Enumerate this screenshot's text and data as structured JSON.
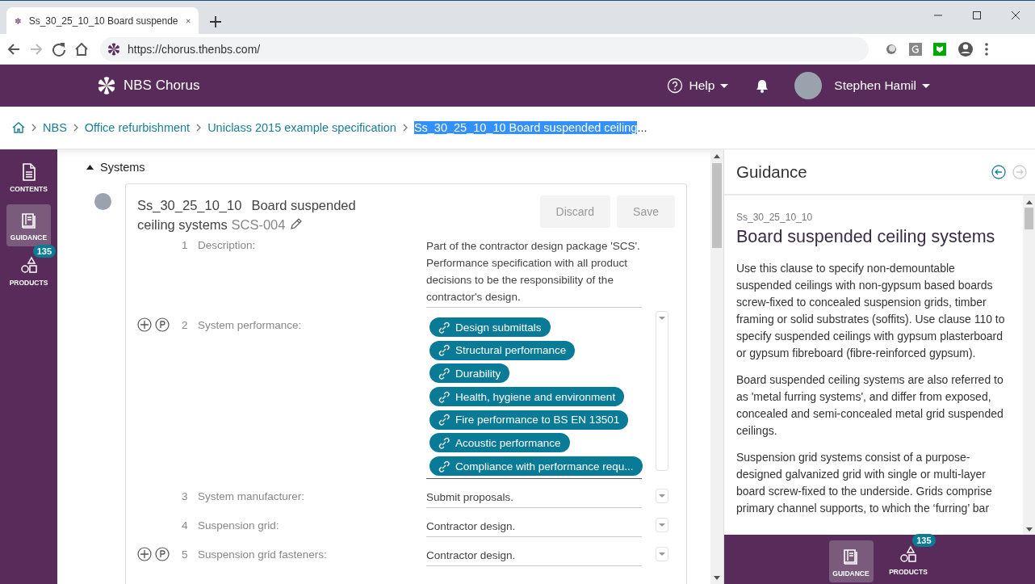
{
  "browser": {
    "tab_title": "Ss_30_25_10_10 Board suspende",
    "url": "https://chorus.thenbs.com/",
    "forward_disabled": true
  },
  "header": {
    "app_name": "NBS Chorus",
    "help": "Help",
    "user": "Stephen Hamil"
  },
  "breadcrumb": {
    "items": [
      "NBS",
      "Office refurbishment",
      "Uniclass 2015 example specification"
    ],
    "current": {
      "text": "Ss_30_25_10_10 Board suspended ceiling",
      "suffix": "...",
      "highlighted": true
    }
  },
  "rail": {
    "items": [
      {
        "kind": "contents",
        "label": "CONTENTS",
        "selected": false
      },
      {
        "kind": "guidance",
        "label": "GUIDANCE",
        "selected": true
      },
      {
        "kind": "products",
        "label": "PRODUCTS",
        "selected": false,
        "badge": "135"
      }
    ]
  },
  "section": {
    "title": "Systems",
    "expanded": true
  },
  "clause": {
    "code": "Ss_30_25_10_10",
    "title": "Board suspended ceiling systems",
    "reference": "SCS-004",
    "buttons": [
      {
        "label": "Discard",
        "disabled": true
      },
      {
        "label": "Save",
        "disabled": true
      }
    ],
    "properties": [
      {
        "kind": "text",
        "number": "1",
        "label": "Description:",
        "actions": false,
        "dropdown": false,
        "value": "Part of the contractor design package 'SCS'. Performance specification with all product decisions to be the responsibility of the contractor's design."
      },
      {
        "kind": "links",
        "number": "2",
        "label": "System performance:",
        "actions": true,
        "dropdown": true,
        "links": [
          "Design submittals",
          "Structural performance",
          "Durability",
          "Health, hygiene and environment",
          "Fire performance to BS EN 13501",
          "Acoustic performance",
          "Compliance with performance requ..."
        ]
      },
      {
        "kind": "text",
        "number": "3",
        "label": "System manufacturer:",
        "actions": false,
        "dropdown": true,
        "value": "Submit proposals."
      },
      {
        "kind": "text",
        "number": "4",
        "label": "Suspension grid:",
        "actions": false,
        "dropdown": true,
        "value": "Contractor design."
      },
      {
        "kind": "text",
        "number": "5",
        "label": "Suspension grid fasteners:",
        "actions": true,
        "dropdown": true,
        "value": "Contractor design."
      }
    ]
  },
  "guidance": {
    "title": "Guidance",
    "back_disabled": false,
    "forward_disabled": true,
    "code": "Ss_30_25_10_10",
    "heading": "Board suspended ceiling systems",
    "paragraphs": [
      "Use this clause to specify non-demountable suspended ceilings with non-gypsum based boards screw-fixed to concealed suspension grids, timber framing or solid substrates (soffits). Use clause 110 to specify suspended ceilings with gypsum plasterboard or gypsum fibreboard (fibre-reinforced gypsum).",
      "Board suspended ceiling systems are also referred to as 'metal furring systems', and differ from exposed, concealed and semi-concealed metal grid suspended ceilings.",
      "Suspension grid systems consist of a purpose-designed galvanized grid with single or multi-layer board screw-fixed to the underside. Grids comprise primary channel supports, to which the ‘furring’ bar"
    ],
    "tabs": [
      {
        "kind": "guidance",
        "label": "GUIDANCE",
        "selected": true
      },
      {
        "kind": "products",
        "label": "PRODUCTS",
        "selected": false,
        "badge": "135"
      }
    ]
  }
}
